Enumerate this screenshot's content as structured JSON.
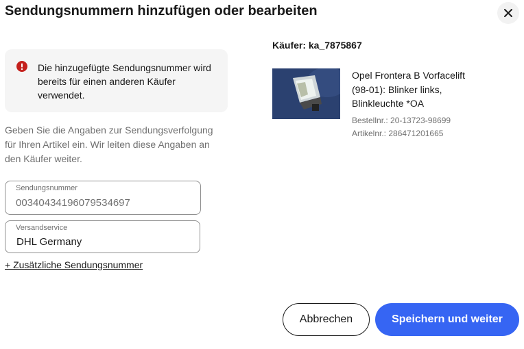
{
  "dialog": {
    "title": "Sendungsnummern hinzufügen oder bearbeiten",
    "close_icon": "close-icon"
  },
  "alert": {
    "icon": "error-icon",
    "text": "Die hinzugefügte Sendungsnummer wird bereits für einen anderen Käufer verwendet.",
    "color": "#c4201c"
  },
  "help_text": "Geben Sie die Angaben zur Sendungsverfolgung für Ihren Artikel ein. Wir leiten diese Angaben an den Käufer weiter.",
  "tracking_field": {
    "label": "Sendungsnummer",
    "value": "00340434196079534697"
  },
  "carrier_field": {
    "label": "Versandservice",
    "value": "DHL Germany"
  },
  "add_tracking_link": "+ Zusätzliche Sendungsnummer",
  "buyer": {
    "label": "Käufer: ka_7875867"
  },
  "item": {
    "thumbnail_icon": "product-image",
    "title": "Opel Frontera B Vorfacelift (98-01): Blinker links, Blinkleuchte *OA",
    "order_number": "Bestellnr.: 20-13723-98699",
    "item_number": "Artikelnr.: 286471201665"
  },
  "buttons": {
    "cancel": "Abbrechen",
    "save": "Speichern und weiter",
    "primary_color": "#3665f3"
  }
}
